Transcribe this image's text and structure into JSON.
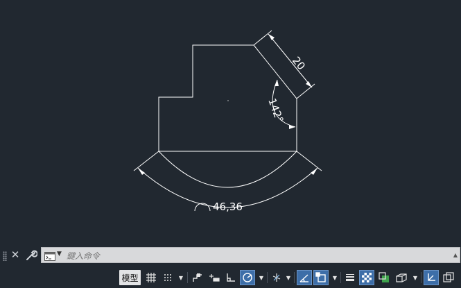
{
  "drawing": {
    "dimension_linear": "20",
    "dimension_angle": "142°",
    "dimension_arc": "46,36"
  },
  "command_line": {
    "placeholder": "鍵入命令",
    "close_icon": "close-icon",
    "customize_icon": "wrench-icon",
    "prompt_icon": "command-prompt-icon"
  },
  "status_bar": {
    "model_tab": "模型",
    "icons": [
      "grid-icon",
      "snap-icon",
      "infer-constraints-icon",
      "dynamic-input-icon",
      "ortho-icon",
      "polar-tracking-icon",
      "isodraft-icon",
      "object-snap-tracking-icon",
      "object-snap-icon",
      "lineweight-icon",
      "transparency-icon",
      "selection-cycling-icon",
      "3d-object-snap-icon",
      "dynamic-ucs-icon",
      "selection-filter-icon"
    ]
  }
}
